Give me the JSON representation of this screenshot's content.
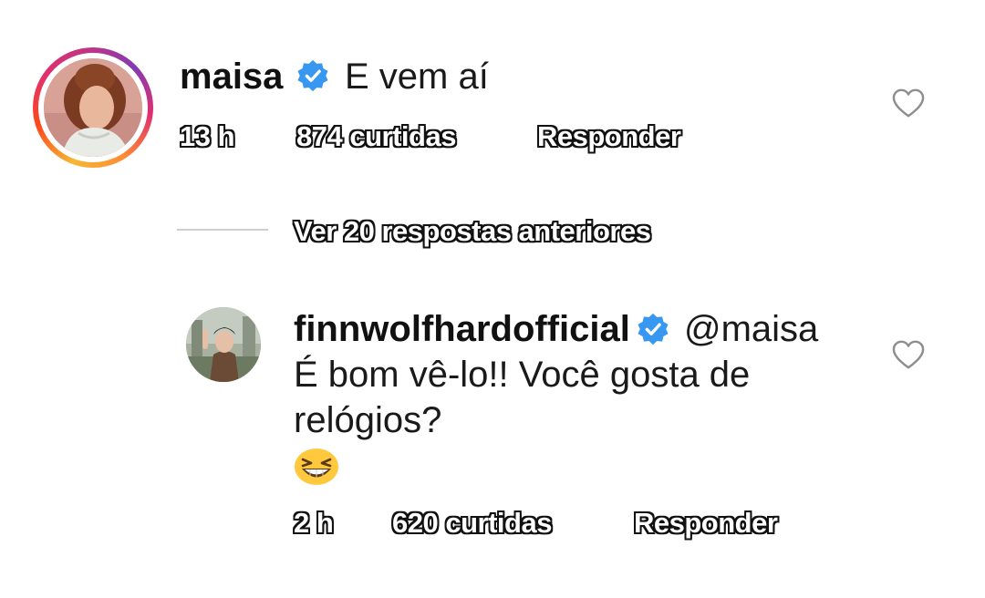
{
  "comment": {
    "username": "maisa",
    "verified": true,
    "text": "E vem aí",
    "time": "13 h",
    "likes": "874 curtidas",
    "reply_label": "Responder",
    "avatar": "avatar-photo-with-story-ring"
  },
  "replies_toggle": {
    "label": "Ver 20 respostas anteriores"
  },
  "reply": {
    "username": "finnwolfhardofficial",
    "verified": true,
    "mention": "@maisa",
    "text_line1": "É bom vê-lo!! Você gosta de",
    "text_line2": "relógios?",
    "emoji": "grinning-squinting-face-emoji",
    "time": "2 h",
    "likes": "620 curtidas",
    "reply_label": "Responder",
    "avatar": "avatar-photo"
  },
  "colors": {
    "verified_badge": "#3897f0",
    "story_ring_start": "#f7b733",
    "story_ring_end": "#c13584",
    "divider": "#cfcfcf"
  },
  "icons": [
    "verified-badge-icon",
    "heart-outline-icon"
  ]
}
